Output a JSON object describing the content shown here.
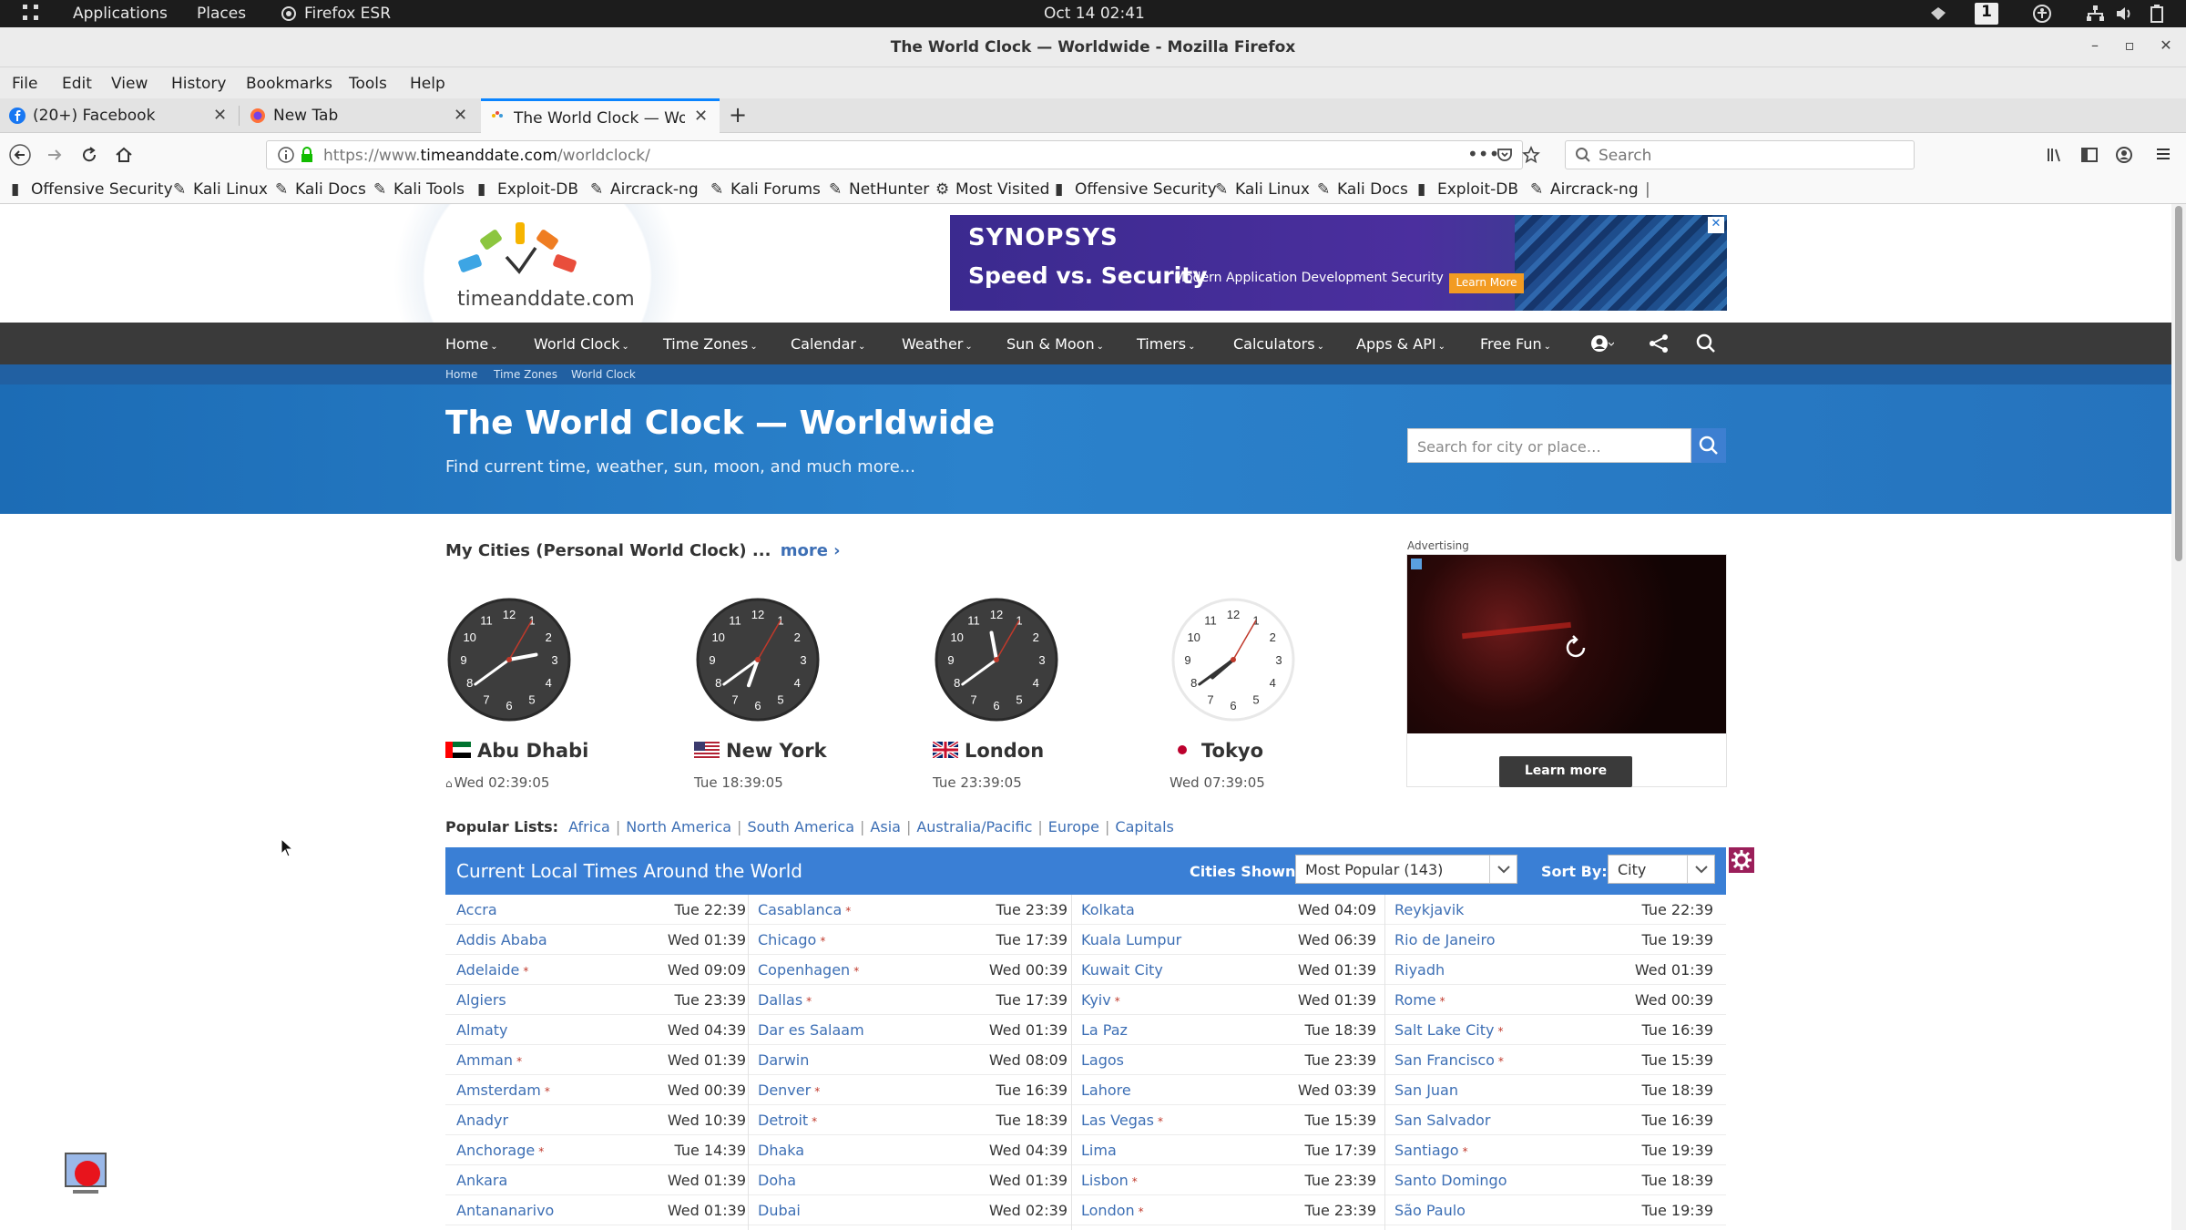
{
  "desktop": {
    "applications": "Applications",
    "places": "Places",
    "browser_app": "Firefox ESR",
    "clock": "Oct 14  02:41",
    "workspace": "1"
  },
  "window": {
    "title": "The World Clock — Worldwide - Mozilla Firefox"
  },
  "menu": [
    "File",
    "Edit",
    "View",
    "History",
    "Bookmarks",
    "Tools",
    "Help"
  ],
  "tabs": [
    {
      "label": "(20+) Facebook"
    },
    {
      "label": "New Tab"
    },
    {
      "label": "The World Clock — Wor"
    }
  ],
  "address": {
    "url_prefix": "https://www.",
    "url_domain": "timeanddate.com",
    "url_path": "/worldclock/",
    "search_placeholder": "Search"
  },
  "bookmarks": [
    "Offensive Security",
    "Kali Linux",
    "Kali Docs",
    "Kali Tools",
    "Exploit-DB",
    "Aircrack-ng",
    "Kali Forums",
    "NetHunter",
    "Most Visited",
    "Offensive Security",
    "Kali Linux",
    "Kali Docs",
    "Exploit-DB",
    "Aircrack-ng"
  ],
  "site": {
    "logo_text": "timeanddate.com",
    "ad_banner": {
      "brand": "SYNOPSYS",
      "headline": "Speed vs. Security",
      "tagline": "Modern Application Development Security",
      "cta": "Learn More"
    },
    "nav": [
      "Home",
      "World Clock",
      "Time Zones",
      "Calendar",
      "Weather",
      "Sun & Moon",
      "Timers",
      "Calculators",
      "Apps & API",
      "Free Fun"
    ],
    "breadcrumb": [
      "Home",
      "Time Zones",
      "World Clock"
    ],
    "hero_title": "The World Clock — Worldwide",
    "hero_subtitle": "Find current time, weather, sun, moon, and much more...",
    "city_search_placeholder": "Search for city or place…",
    "my_cities_title": "My Cities (Personal World Clock) ...",
    "more_link": "more ›",
    "advertising_label": "Advertising",
    "ad_learn_more": "Learn more",
    "popular_label": "Popular Lists:",
    "popular_lists": [
      "Africa",
      "North America",
      "South America",
      "Asia",
      "Australia/Pacific",
      "Europe",
      "Capitals"
    ],
    "table_title": "Current Local Times Around the World",
    "cities_shown_label": "Cities Shown:",
    "cities_shown_value": "Most Popular (143)",
    "sort_by_label": "Sort By:",
    "sort_by_value": "City"
  },
  "my_cities": [
    {
      "name": "Abu Dhabi",
      "time": "Wed 02:39:05",
      "hour": 2,
      "minute": 39,
      "second": 5,
      "night": true
    },
    {
      "name": "New York",
      "time": "Tue 18:39:05",
      "hour": 18,
      "minute": 39,
      "second": 5,
      "night": true
    },
    {
      "name": "London",
      "time": "Tue 23:39:05",
      "hour": 23,
      "minute": 39,
      "second": 5,
      "night": true
    },
    {
      "name": "Tokyo",
      "time": "Wed 07:39:05",
      "hour": 7,
      "minute": 39,
      "second": 5,
      "night": false
    }
  ],
  "world_times": {
    "col1": [
      {
        "city": "Accra",
        "dst": false,
        "time": "Tue 22:39"
      },
      {
        "city": "Addis Ababa",
        "dst": false,
        "time": "Wed 01:39"
      },
      {
        "city": "Adelaide",
        "dst": true,
        "time": "Wed 09:09"
      },
      {
        "city": "Algiers",
        "dst": false,
        "time": "Tue 23:39"
      },
      {
        "city": "Almaty",
        "dst": false,
        "time": "Wed 04:39"
      },
      {
        "city": "Amman",
        "dst": true,
        "time": "Wed 01:39"
      },
      {
        "city": "Amsterdam",
        "dst": true,
        "time": "Wed 00:39"
      },
      {
        "city": "Anadyr",
        "dst": false,
        "time": "Wed 10:39"
      },
      {
        "city": "Anchorage",
        "dst": true,
        "time": "Tue 14:39"
      },
      {
        "city": "Ankara",
        "dst": false,
        "time": "Wed 01:39"
      },
      {
        "city": "Antananarivo",
        "dst": false,
        "time": "Wed 01:39"
      }
    ],
    "col2": [
      {
        "city": "Casablanca",
        "dst": true,
        "time": "Tue 23:39"
      },
      {
        "city": "Chicago",
        "dst": true,
        "time": "Tue 17:39"
      },
      {
        "city": "Copenhagen",
        "dst": true,
        "time": "Wed 00:39"
      },
      {
        "city": "Dallas",
        "dst": true,
        "time": "Tue 17:39"
      },
      {
        "city": "Dar es Salaam",
        "dst": false,
        "time": "Wed 01:39"
      },
      {
        "city": "Darwin",
        "dst": false,
        "time": "Wed 08:09"
      },
      {
        "city": "Denver",
        "dst": true,
        "time": "Tue 16:39"
      },
      {
        "city": "Detroit",
        "dst": true,
        "time": "Tue 18:39"
      },
      {
        "city": "Dhaka",
        "dst": false,
        "time": "Wed 04:39"
      },
      {
        "city": "Doha",
        "dst": false,
        "time": "Wed 01:39"
      },
      {
        "city": "Dubai",
        "dst": false,
        "time": "Wed 02:39"
      }
    ],
    "col3": [
      {
        "city": "Kolkata",
        "dst": false,
        "time": "Wed 04:09"
      },
      {
        "city": "Kuala Lumpur",
        "dst": false,
        "time": "Wed 06:39"
      },
      {
        "city": "Kuwait City",
        "dst": false,
        "time": "Wed 01:39"
      },
      {
        "city": "Kyiv",
        "dst": true,
        "time": "Wed 01:39"
      },
      {
        "city": "La Paz",
        "dst": false,
        "time": "Tue 18:39"
      },
      {
        "city": "Lagos",
        "dst": false,
        "time": "Tue 23:39"
      },
      {
        "city": "Lahore",
        "dst": false,
        "time": "Wed 03:39"
      },
      {
        "city": "Las Vegas",
        "dst": true,
        "time": "Tue 15:39"
      },
      {
        "city": "Lima",
        "dst": false,
        "time": "Tue 17:39"
      },
      {
        "city": "Lisbon",
        "dst": true,
        "time": "Tue 23:39"
      },
      {
        "city": "London",
        "dst": true,
        "time": "Tue 23:39"
      }
    ],
    "col4": [
      {
        "city": "Reykjavik",
        "dst": false,
        "time": "Tue 22:39"
      },
      {
        "city": "Rio de Janeiro",
        "dst": false,
        "time": "Tue 19:39"
      },
      {
        "city": "Riyadh",
        "dst": false,
        "time": "Wed 01:39"
      },
      {
        "city": "Rome",
        "dst": true,
        "time": "Wed 00:39"
      },
      {
        "city": "Salt Lake City",
        "dst": true,
        "time": "Tue 16:39"
      },
      {
        "city": "San Francisco",
        "dst": true,
        "time": "Tue 15:39"
      },
      {
        "city": "San Juan",
        "dst": false,
        "time": "Tue 18:39"
      },
      {
        "city": "San Salvador",
        "dst": false,
        "time": "Tue 16:39"
      },
      {
        "city": "Santiago",
        "dst": true,
        "time": "Tue 19:39"
      },
      {
        "city": "Santo Domingo",
        "dst": false,
        "time": "Tue 18:39"
      },
      {
        "city": "São Paulo",
        "dst": false,
        "time": "Tue 19:39"
      }
    ]
  },
  "colors": {
    "nav_bg": "#3a3a3a",
    "hero_blue": "#2573bd",
    "table_head": "#3a7fd5",
    "link": "#3d6fb5",
    "dst_mark": "#c0392b",
    "ad_purple": "#3b2a8f"
  }
}
